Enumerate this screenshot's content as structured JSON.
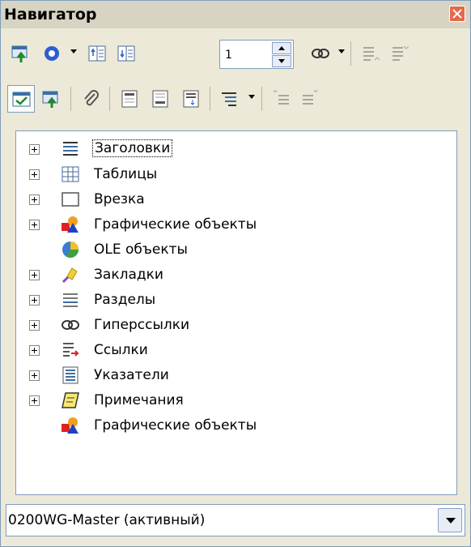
{
  "window": {
    "title": "Навигатор"
  },
  "toolbar1": {
    "page_number_value": "1",
    "buttons": [
      "navigation-toggle-icon",
      "navigation-icon",
      "previous-icon",
      "next-icon",
      "hyperlink-drag-mode-icon",
      "promote-level-icon",
      "demote-level-icon"
    ]
  },
  "toolbar2": {
    "buttons": [
      "content-view-icon",
      "list-box-icon",
      "reminder-icon",
      "header-icon",
      "footer-icon",
      "anchor-icon",
      "heading-levels-icon",
      "promote-chapter-icon",
      "demote-chapter-icon"
    ]
  },
  "tree": {
    "items": [
      {
        "label": "Заголовки",
        "expandable": true,
        "icon": "headings-icon",
        "selected": true
      },
      {
        "label": "Таблицы",
        "expandable": true,
        "icon": "tables-icon"
      },
      {
        "label": "Врезка",
        "expandable": true,
        "icon": "frames-icon"
      },
      {
        "label": "Графические объекты",
        "expandable": true,
        "icon": "graphics-icon"
      },
      {
        "label": "OLE объекты",
        "expandable": false,
        "icon": "ole-objects-icon"
      },
      {
        "label": "Закладки",
        "expandable": true,
        "icon": "bookmarks-icon"
      },
      {
        "label": "Разделы",
        "expandable": true,
        "icon": "sections-icon"
      },
      {
        "label": "Гиперссылки",
        "expandable": true,
        "icon": "hyperlinks-icon"
      },
      {
        "label": "Ссылки",
        "expandable": true,
        "icon": "references-icon"
      },
      {
        "label": "Указатели",
        "expandable": true,
        "icon": "indexes-icon"
      },
      {
        "label": "Примечания",
        "expandable": true,
        "icon": "comments-icon"
      },
      {
        "label": "Графические объекты",
        "expandable": false,
        "icon": "drawing-objects-icon"
      }
    ]
  },
  "document_select": {
    "value": "0200WG-Master (активный)"
  },
  "colors": {
    "panel_bg": "#ece9d8",
    "border": "#7f9db9",
    "close_button": "#e36a4a"
  }
}
